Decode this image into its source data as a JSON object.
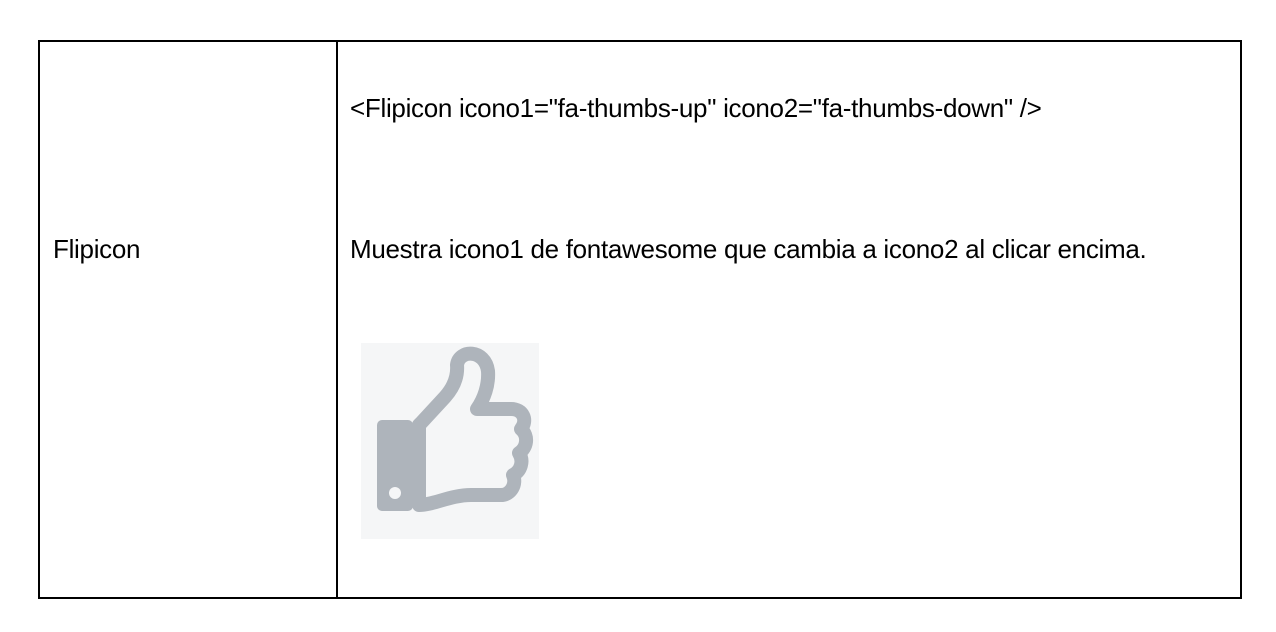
{
  "row": {
    "name": "Flipicon",
    "usage": "<Flipicon icono1=\"fa-thumbs-up\" icono2=\"fa-thumbs-down\" />",
    "description": "Muestra icono1 de fontawesome que cambia a icono2 al clicar encima.",
    "preview_icon": "thumbs-up-icon",
    "preview_icon_color": "#aeb4bb",
    "preview_background": "#f5f6f7"
  }
}
